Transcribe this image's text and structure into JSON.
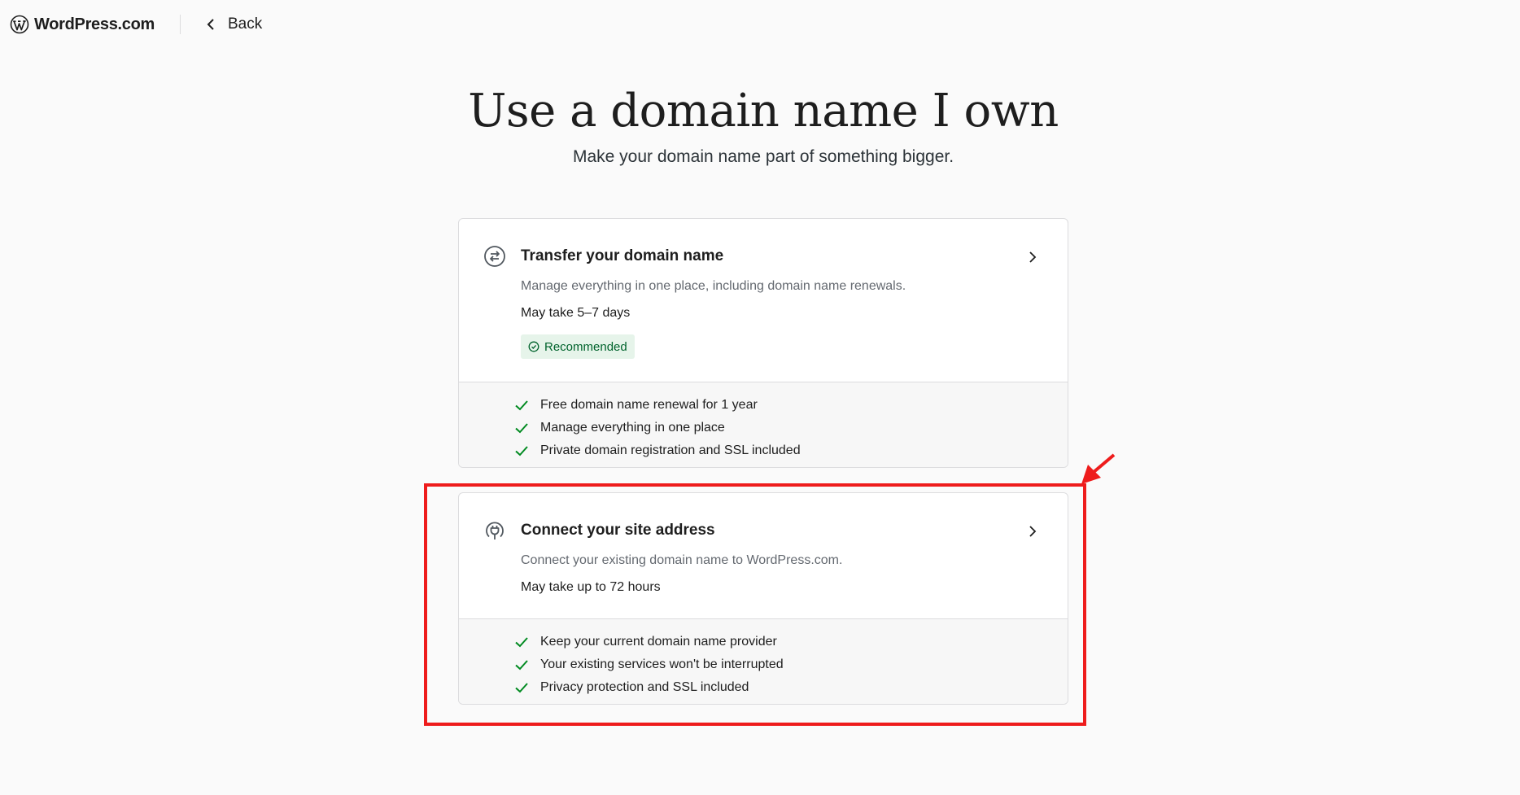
{
  "header": {
    "logo_text": "WordPress.com",
    "back_label": "Back"
  },
  "page": {
    "title": "Use a domain name I own",
    "subtitle": "Make your domain name part of something bigger."
  },
  "options": [
    {
      "title": "Transfer your domain name",
      "description": "Manage everything in one place, including domain name renewals.",
      "time": "May take 5–7 days",
      "badge": "Recommended",
      "features": [
        "Free domain name renewal for 1 year",
        "Manage everything in one place",
        "Private domain registration and SSL included"
      ]
    },
    {
      "title": "Connect your site address",
      "description": "Connect your existing domain name to WordPress.com.",
      "time": "May take up to 72 hours",
      "features": [
        "Keep your current domain name provider",
        "Your existing services won't be interrupted",
        "Privacy protection and SSL included"
      ]
    }
  ],
  "icons": {
    "logo": "wordpress-logo-icon",
    "back": "chevron-left-icon",
    "transfer": "transfer-arrows-icon",
    "connect": "plug-icon",
    "open": "chevron-right-icon",
    "check": "checkmark-icon",
    "badge": "check-circle-icon"
  },
  "colors": {
    "check_green": "#008a20",
    "badge_bg": "#e6f4ea",
    "badge_text": "#00632c",
    "annotation_red": "#ee1c1c"
  }
}
